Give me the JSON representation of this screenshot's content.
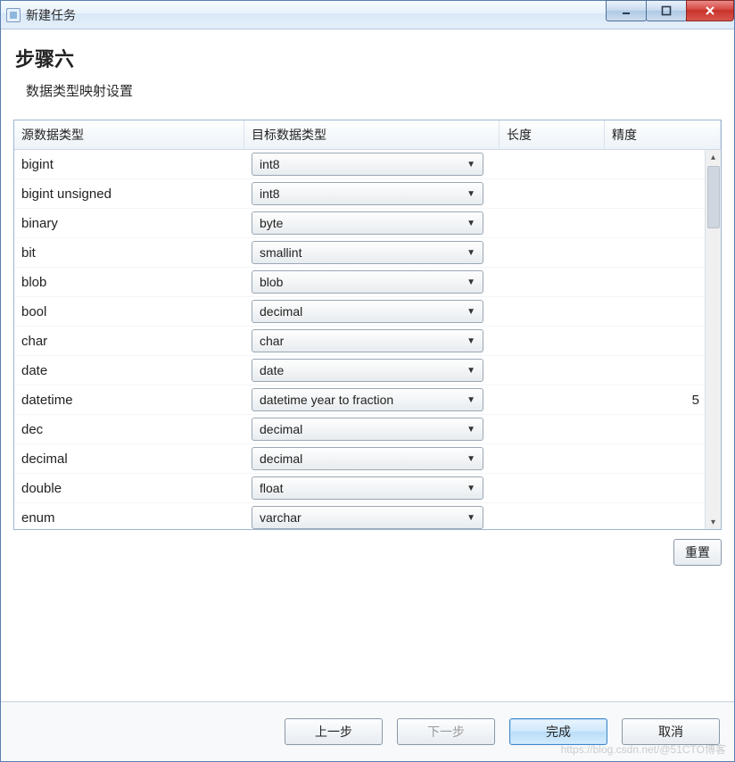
{
  "window": {
    "title": "新建任务"
  },
  "wizard": {
    "step_title": "步骤六",
    "step_subtitle": "数据类型映射设置"
  },
  "columns": {
    "source": "源数据类型",
    "target": "目标数据类型",
    "length": "长度",
    "precision": "精度"
  },
  "rows": [
    {
      "source": "bigint",
      "target": "int8",
      "length": "",
      "precision": ""
    },
    {
      "source": "bigint unsigned",
      "target": "int8",
      "length": "",
      "precision": ""
    },
    {
      "source": "binary",
      "target": "byte",
      "length": "",
      "precision": ""
    },
    {
      "source": "bit",
      "target": "smallint",
      "length": "",
      "precision": ""
    },
    {
      "source": "blob",
      "target": "blob",
      "length": "",
      "precision": ""
    },
    {
      "source": "bool",
      "target": "decimal",
      "length": "",
      "precision": ""
    },
    {
      "source": "char",
      "target": "char",
      "length": "",
      "precision": ""
    },
    {
      "source": "date",
      "target": "date",
      "length": "",
      "precision": ""
    },
    {
      "source": "datetime",
      "target": "datetime year to fraction",
      "length": "",
      "precision": "5"
    },
    {
      "source": "dec",
      "target": "decimal",
      "length": "",
      "precision": ""
    },
    {
      "source": "decimal",
      "target": "decimal",
      "length": "",
      "precision": ""
    },
    {
      "source": "double",
      "target": "float",
      "length": "",
      "precision": ""
    },
    {
      "source": "enum",
      "target": "varchar",
      "length": "",
      "precision": ""
    }
  ],
  "buttons": {
    "reset": "重置",
    "back": "上一步",
    "next": "下一步",
    "finish": "完成",
    "cancel": "取消"
  },
  "watermark": "https://blog.csdn.net/@51CTO博客"
}
